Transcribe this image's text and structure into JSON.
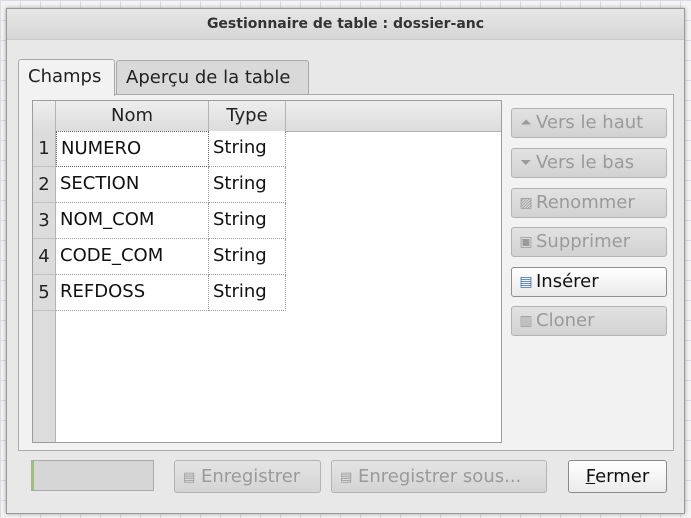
{
  "window": {
    "title": "Gestionnaire de table : dossier-anc"
  },
  "tabs": [
    {
      "label": "Champs",
      "active": true
    },
    {
      "label": "Aperçu de la table",
      "active": false
    }
  ],
  "table": {
    "columns": [
      "Nom",
      "Type"
    ],
    "rows": [
      {
        "num": "1",
        "nom": "NUMERO",
        "type": "String"
      },
      {
        "num": "2",
        "nom": "SECTION",
        "type": "String"
      },
      {
        "num": "3",
        "nom": "NOM_COM",
        "type": "String"
      },
      {
        "num": "4",
        "nom": "CODE_COM",
        "type": "String"
      },
      {
        "num": "5",
        "nom": "REFDOSS",
        "type": "String"
      }
    ]
  },
  "side_buttons": [
    {
      "label": "Vers le haut",
      "icon": "up-triangle-icon",
      "enabled": false
    },
    {
      "label": "Vers le bas",
      "icon": "down-triangle-icon",
      "enabled": false
    },
    {
      "label": "Renommer",
      "icon": "rename-icon",
      "enabled": false
    },
    {
      "label": "Supprimer",
      "icon": "delete-icon",
      "enabled": false
    },
    {
      "label": "Insérer",
      "icon": "insert-icon",
      "enabled": true
    },
    {
      "label": "Cloner",
      "icon": "clone-icon",
      "enabled": false
    }
  ],
  "footer": {
    "progress_fraction": 0.02,
    "save_label": "Enregistrer",
    "save_as_label": "Enregistrer sous...",
    "close_label_first": "F",
    "close_label_rest": "ermer"
  }
}
